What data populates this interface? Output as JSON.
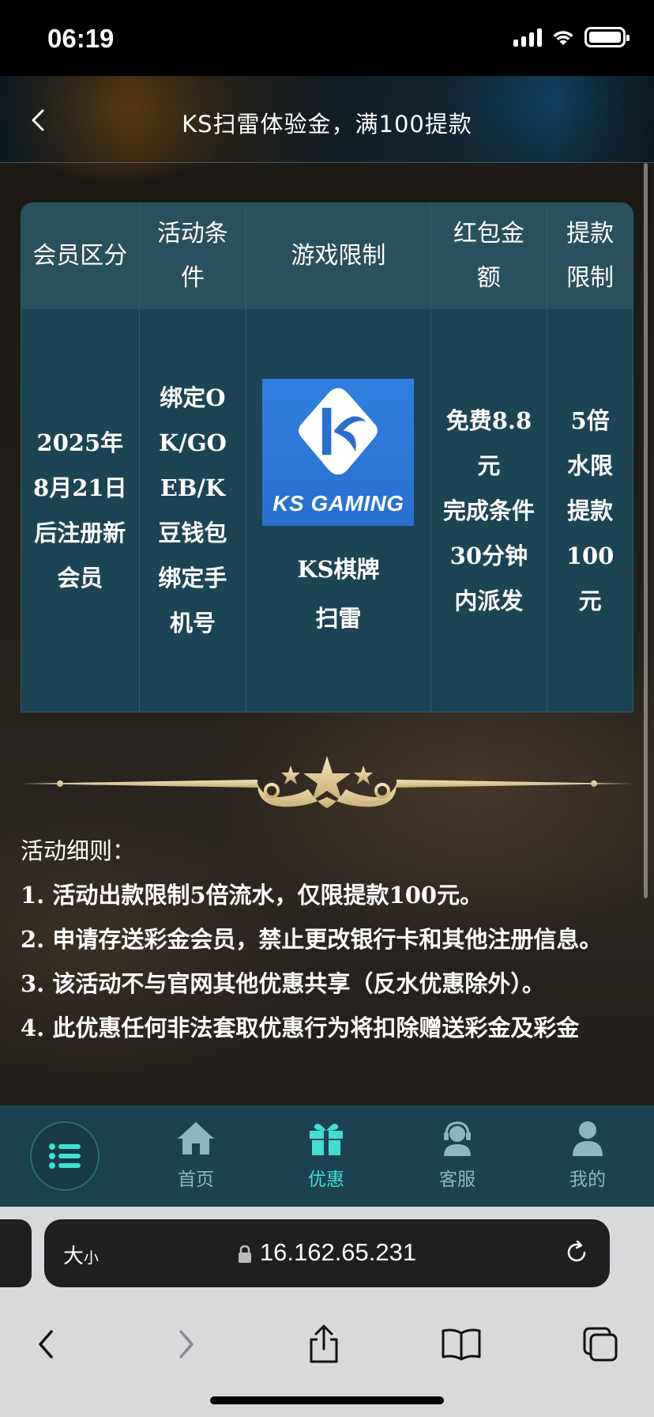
{
  "status_bar": {
    "time": "06:19"
  },
  "header": {
    "title": "KS扫雷体验金，满100提款"
  },
  "table": {
    "headers": [
      "会员区分",
      "活动条件",
      "游戏限制",
      "红包金额",
      "提款限制"
    ],
    "row": {
      "member": "2025年8月21日后注册新会员",
      "condition": "绑定OK/GOEB/K豆钱包绑定手机号",
      "logo_text": "KS GAMING",
      "game_line1": "KS棋牌",
      "game_line2": "扫雷",
      "amount_line1": "免费8.8元",
      "amount_line2": "完成条件",
      "amount_line3": "30分钟内派发",
      "withdraw": "5倍水限提款100元"
    }
  },
  "rules": {
    "title": "活动细则：",
    "items": [
      "1. 活动出款限制5倍流水，仅限提款100元。",
      "2. 申请存送彩金会员，禁止更改银行卡和其他注册信息。",
      "3. 该活动不与官网其他优惠共享（反水优惠除外）。",
      "4. 此优惠任何非法套取优惠行为将扣除赠送彩金及彩金"
    ]
  },
  "tab_bar": {
    "items": [
      {
        "label": "首页",
        "icon": "home-icon"
      },
      {
        "label": "优惠",
        "icon": "gift-icon",
        "active": true
      },
      {
        "label": "客服",
        "icon": "support-icon"
      },
      {
        "label": "我的",
        "icon": "user-icon"
      }
    ]
  },
  "browser": {
    "text_size_big": "大",
    "text_size_small": "小",
    "url": "16.162.65.231"
  },
  "colors": {
    "table_header": "#2a4f5e",
    "table_body": "#1c4455",
    "tab_bar": "#1d4150",
    "active_tab": "#3fe0d0",
    "gold": "#e8d3a2"
  }
}
